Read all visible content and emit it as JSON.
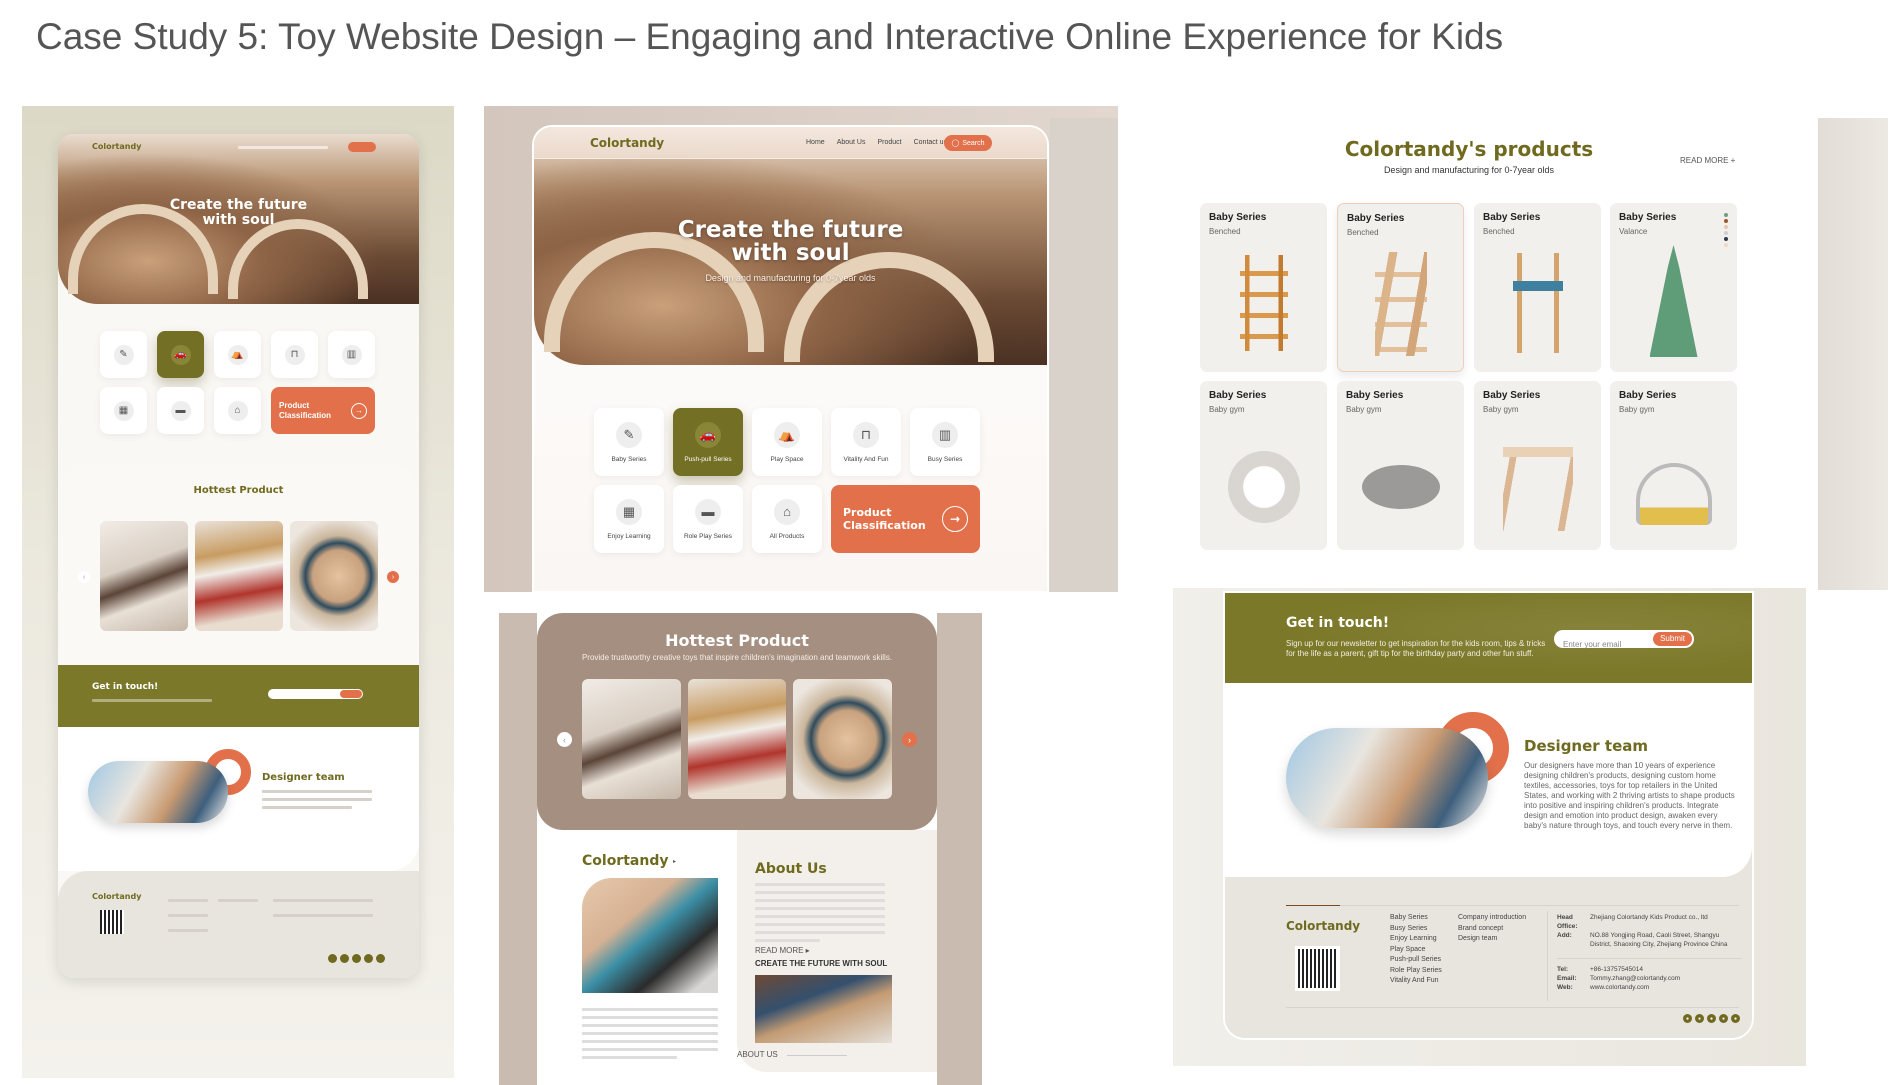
{
  "slide": {
    "title": "Case Study 5: Toy Website Design – Engaging and Interactive Online Experience for Kids"
  },
  "colors": {
    "olive": "#736f24",
    "orange": "#e2714b",
    "mocha": "#a58f80",
    "footer": "#e8e5df"
  },
  "site": {
    "logo": "Colortandy",
    "nav": [
      "Home",
      "About Us",
      "Product",
      "Contact us"
    ],
    "search_label": "Search",
    "hero": {
      "title": "Create the future with soul",
      "subtitle": "Design and manufacturing for 0-7year olds"
    },
    "categories": [
      {
        "label": "Baby Series",
        "icon": "pacifier-icon",
        "glyph": "✎",
        "active": false
      },
      {
        "label": "Push-pull Series",
        "icon": "car-icon",
        "glyph": "🚗",
        "active": true
      },
      {
        "label": "Play Space",
        "icon": "tent-icon",
        "glyph": "⛺",
        "active": false
      },
      {
        "label": "Vitality And Fun",
        "icon": "swing-icon",
        "glyph": "⊓",
        "active": false
      },
      {
        "label": "Busy Series",
        "icon": "xylophone-icon",
        "glyph": "▥",
        "active": false
      },
      {
        "label": "Enjoy Learning",
        "icon": "blocks-icon",
        "glyph": "▦",
        "active": false
      },
      {
        "label": "Role Play Series",
        "icon": "train-icon",
        "glyph": "▬",
        "active": false
      },
      {
        "label": "All Products",
        "icon": "house-icon",
        "glyph": "⌂",
        "active": false
      }
    ],
    "classification": {
      "label": "Product Classification",
      "arrow": "→"
    },
    "hottest": {
      "title": "Hottest Product",
      "subtitle": "Provide trustworthy creative toys that inspire children's imagination and teamwork skills."
    },
    "about": {
      "brand": "Colortandy",
      "read_more": "READ MORE",
      "title": "About Us",
      "tagline": "CREATE THE FUTURE WITH SOUL",
      "footer_label": "ABOUT US"
    },
    "products": {
      "title": "Colortandy's products",
      "subtitle": "Design and manufacturing for 0-7year olds",
      "read_more": "READ MORE",
      "items": [
        {
          "title": "Baby Series",
          "subtitle": "Benched"
        },
        {
          "title": "Baby Series",
          "subtitle": "Benched"
        },
        {
          "title": "Baby Series",
          "subtitle": "Benched"
        },
        {
          "title": "Baby Series",
          "subtitle": "Valance"
        },
        {
          "title": "Baby Series",
          "subtitle": "Baby gym"
        },
        {
          "title": "Baby Series",
          "subtitle": "Baby gym"
        },
        {
          "title": "Baby Series",
          "subtitle": "Baby gym"
        },
        {
          "title": "Baby Series",
          "subtitle": "Baby gym"
        }
      ]
    },
    "contact": {
      "title": "Get in touch!",
      "text": "Sign up for our newsletter to get inspiration for the kids room, tips & tricks for the life as a parent, gift tip for the birthday party and other fun stuff.",
      "email_placeholder": "Enter your email",
      "submit": "Submit"
    },
    "designer": {
      "title": "Designer team",
      "text": "Our designers have more than 10 years of experience designing children's products, designing custom home textiles, accessories, toys for top retailers in the United States, and working with 2 thriving artists to shape products into positive and inspiring children's products. Integrate design and emotion into product design, awaken every baby's nature through toys, and touch every nerve in them."
    },
    "footer": {
      "logo": "Colortandy",
      "series": [
        "Baby Series",
        "Busy Series",
        "Enjoy Learning",
        "Play Space",
        "Push-pull Series",
        "Role Play Series",
        "Vitality And Fun"
      ],
      "company": [
        "Company introduction",
        "Brand concept",
        "Design team"
      ],
      "contact": [
        {
          "label": "Head Office:",
          "value": "Zhejiang Colortandy Kids Product co., ltd"
        },
        {
          "label": "Add:",
          "value": "NO.88 Yongjing Road, Caoli Street, Shangyu District, Shaoxing City, Zhejiang Province China"
        },
        {
          "label": "Tel:",
          "value": "+86-13757545014"
        },
        {
          "label": "Email:",
          "value": "Tommy.zhang@colortandy.com"
        },
        {
          "label": "Web:",
          "value": "www.colortandy.com"
        }
      ],
      "socials": [
        "facebook-icon",
        "pinterest-icon",
        "tiktok-icon",
        "youtube-icon",
        "instagram-icon"
      ]
    }
  }
}
